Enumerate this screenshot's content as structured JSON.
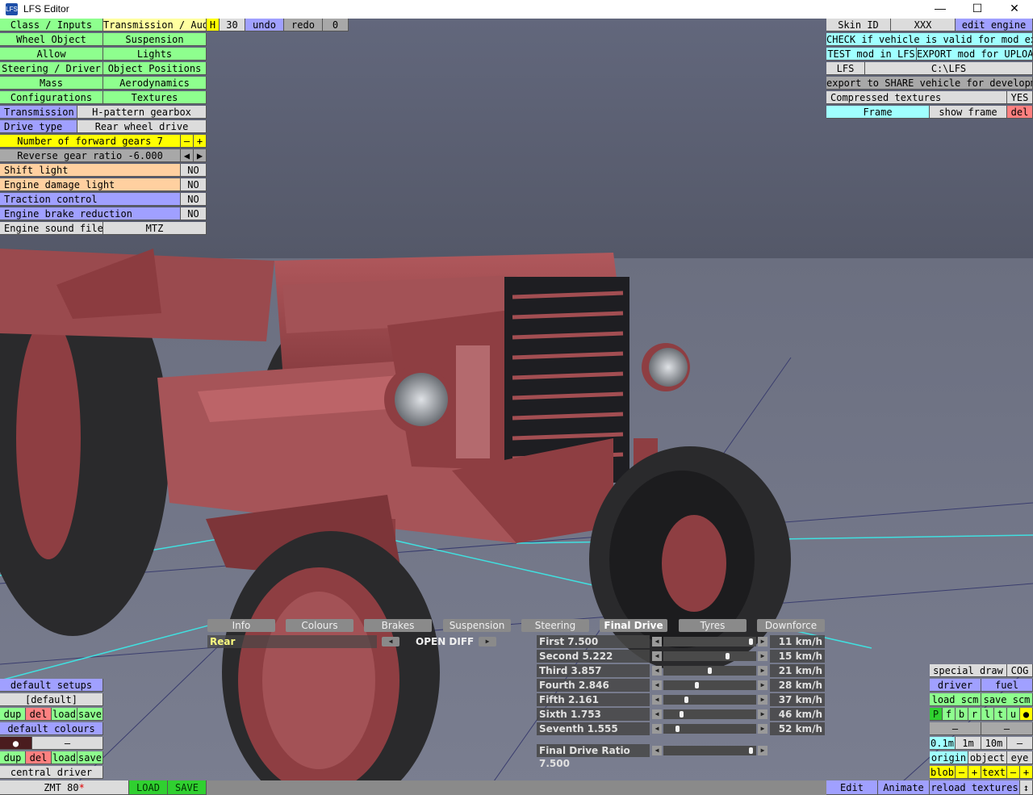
{
  "window": {
    "title": "LFS Editor",
    "icon": "LFS",
    "minimize": "—",
    "maximize": "☐",
    "close": "✕"
  },
  "menu_left": {
    "class_inputs": "Class / Inputs",
    "transmission_audio": "Transmission / Audio",
    "h": "H",
    "num30": "30",
    "undo": "undo",
    "redo": "redo",
    "zero": "0",
    "wheel_object": "Wheel Object",
    "suspension": "Suspension",
    "allow": "Allow",
    "lights": "Lights",
    "steering_driver": "Steering / Driver",
    "object_positions": "Object Positions",
    "mass": "Mass",
    "aerodynamics": "Aerodynamics",
    "configurations": "Configurations",
    "textures": "Textures"
  },
  "settings": {
    "transmission_label": "Transmission",
    "transmission_value": "H-pattern gearbox",
    "drive_type_label": "Drive type",
    "drive_type_value": "Rear wheel drive",
    "forward_gears": "Number of forward gears 7",
    "minus": "–",
    "plus": "+",
    "reverse_ratio": "Reverse gear ratio -6.000",
    "left": "◀",
    "right": "▶",
    "shift_light": "Shift light",
    "shift_light_value": "NO",
    "engine_damage_light": "Engine damage light",
    "engine_damage_value": "NO",
    "traction_control": "Traction control",
    "traction_value": "NO",
    "engine_brake": "Engine brake reduction",
    "engine_brake_value": "NO",
    "engine_sound": "Engine sound file",
    "engine_sound_value": "MTZ"
  },
  "menu_right": {
    "skin_id": "Skin ID",
    "xxx": "XXX",
    "edit_engine": "edit engine",
    "check_valid": "CHECK if vehicle is valid for mod export",
    "test_mod": "TEST mod in LFS",
    "export_mod": "EXPORT mod for UPLOAD",
    "lfs": "LFS",
    "lfs_path": "C:\\LFS",
    "export_share": "export to SHARE vehicle for development",
    "compressed": "Compressed textures",
    "compressed_value": "YES",
    "frame": "Frame",
    "show_frame": "show frame",
    "del": "del"
  },
  "tabs": [
    "Info",
    "Colours",
    "Brakes",
    "Suspension",
    "Steering",
    "Final Drive",
    "Tyres",
    "Downforce"
  ],
  "diff": {
    "axle": "Rear",
    "type": "OPEN DIFF",
    "left": "◀",
    "right": "▶"
  },
  "gears": [
    {
      "label": "First 7.500",
      "speed": "11 km/h",
      "pos": 0.96
    },
    {
      "label": "Second 5.222",
      "speed": "15 km/h",
      "pos": 0.7
    },
    {
      "label": "Third 3.857",
      "speed": "21 km/h",
      "pos": 0.5
    },
    {
      "label": "Fourth 2.846",
      "speed": "28 km/h",
      "pos": 0.35
    },
    {
      "label": "Fifth 2.161",
      "speed": "37 km/h",
      "pos": 0.24
    },
    {
      "label": "Sixth 1.753",
      "speed": "46 km/h",
      "pos": 0.18
    },
    {
      "label": "Seventh 1.555",
      "speed": "52 km/h",
      "pos": 0.14
    }
  ],
  "final_drive": {
    "label": "Final Drive Ratio 7.500",
    "pos": 0.96
  },
  "bottom_left": {
    "default_setups": "default setups",
    "default_setup_value": "[default]",
    "dup": "dup",
    "del": "del",
    "load": "load",
    "save": "save",
    "default_colours": "default colours",
    "dot": "●",
    "dash": "–",
    "central_driver": "central driver",
    "car_name": "ZMT 80",
    "modified_mark": "*",
    "load_btn": "LOAD",
    "save_btn": "SAVE"
  },
  "bottom_right": {
    "special_draw": "special draw",
    "cog": "COG",
    "driver": "driver",
    "fuel": "fuel",
    "load_scm": "load scm",
    "save_scm": "save scm",
    "letters": [
      "P",
      "f",
      "b",
      "r",
      "l",
      "t",
      "u",
      "●"
    ],
    "dash": "–",
    "s01": "0.1m",
    "s1": "1m",
    "s10": "10m",
    "minus": "–",
    "origin": "origin",
    "object": "object",
    "eye": "eye",
    "blob": "blob",
    "plus": "+",
    "text": "text",
    "edit": "Edit",
    "animate": "Animate",
    "reload_textures": "reload textures",
    "arrow": "↕"
  },
  "colors": {
    "green": "#8eff8e",
    "purple": "#a0a0ff",
    "yellow": "#ffff00",
    "cyan": "#a0ffff",
    "orange": "#ffd0a0",
    "tractor_red": "#8e3e42"
  }
}
